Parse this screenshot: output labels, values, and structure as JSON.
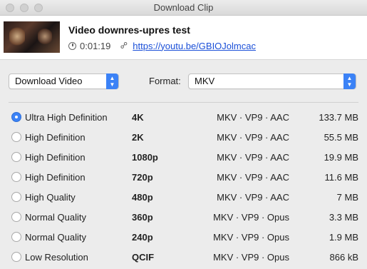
{
  "window": {
    "title": "Download Clip"
  },
  "clip": {
    "title": "Video downres-upres test",
    "duration": "0:01:19",
    "url": "https://youtu.be/GBIOJolmcac"
  },
  "controls": {
    "action": "Download Video",
    "format_label": "Format:",
    "format_value": "MKV"
  },
  "options": [
    {
      "quality": "Ultra High Definition",
      "resolution": "4K",
      "codec": "MKV · VP9 · AAC",
      "size": "133.7 MB",
      "selected": true
    },
    {
      "quality": "High Definition",
      "resolution": "2K",
      "codec": "MKV · VP9 · AAC",
      "size": "55.5 MB",
      "selected": false
    },
    {
      "quality": "High Definition",
      "resolution": "1080p",
      "codec": "MKV · VP9 · AAC",
      "size": "19.9 MB",
      "selected": false
    },
    {
      "quality": "High Definition",
      "resolution": "720p",
      "codec": "MKV · VP9 · AAC",
      "size": "11.6 MB",
      "selected": false
    },
    {
      "quality": "High Quality",
      "resolution": "480p",
      "codec": "MKV · VP9 · AAC",
      "size": "7 MB",
      "selected": false
    },
    {
      "quality": "Normal Quality",
      "resolution": "360p",
      "codec": "MKV · VP9 · Opus",
      "size": "3.3 MB",
      "selected": false
    },
    {
      "quality": "Normal Quality",
      "resolution": "240p",
      "codec": "MKV · VP9 · Opus",
      "size": "1.9 MB",
      "selected": false
    },
    {
      "quality": "Low Resolution",
      "resolution": "QCIF",
      "codec": "MKV · VP9 · Opus",
      "size": "866 kB",
      "selected": false
    }
  ],
  "colors": {
    "accent": "#3b82f6",
    "link": "#1a4fd8"
  }
}
